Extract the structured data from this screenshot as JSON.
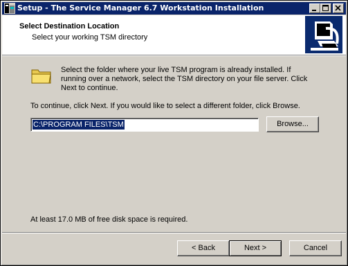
{
  "window": {
    "title": "Setup - The Service Manager 6.7 Workstation Installation"
  },
  "header": {
    "title": "Select Destination Location",
    "subtitle": "Select your working TSM directory"
  },
  "body": {
    "description": "Select the folder where your live TSM program is already installed. If running over a network, select the TSM directory on your file server. Click Next to continue.",
    "instruction": "To continue, click Next. If you would like to select a different folder, click Browse.",
    "path_value": "C:\\PROGRAM FILES\\TSM",
    "browse_label": "Browse...",
    "disk_space": "At least 17.0 MB of free disk space is required."
  },
  "buttons": {
    "back": "< Back",
    "next": "Next >",
    "cancel": "Cancel"
  },
  "icons": [
    "setup-app-icon",
    "minimize-icon",
    "maximize-icon",
    "close-icon",
    "workstation-logo-icon",
    "folder-icon"
  ],
  "colors": {
    "titlebar": "#0a246a",
    "face": "#d4d0c8",
    "selection": "#0a246a"
  }
}
